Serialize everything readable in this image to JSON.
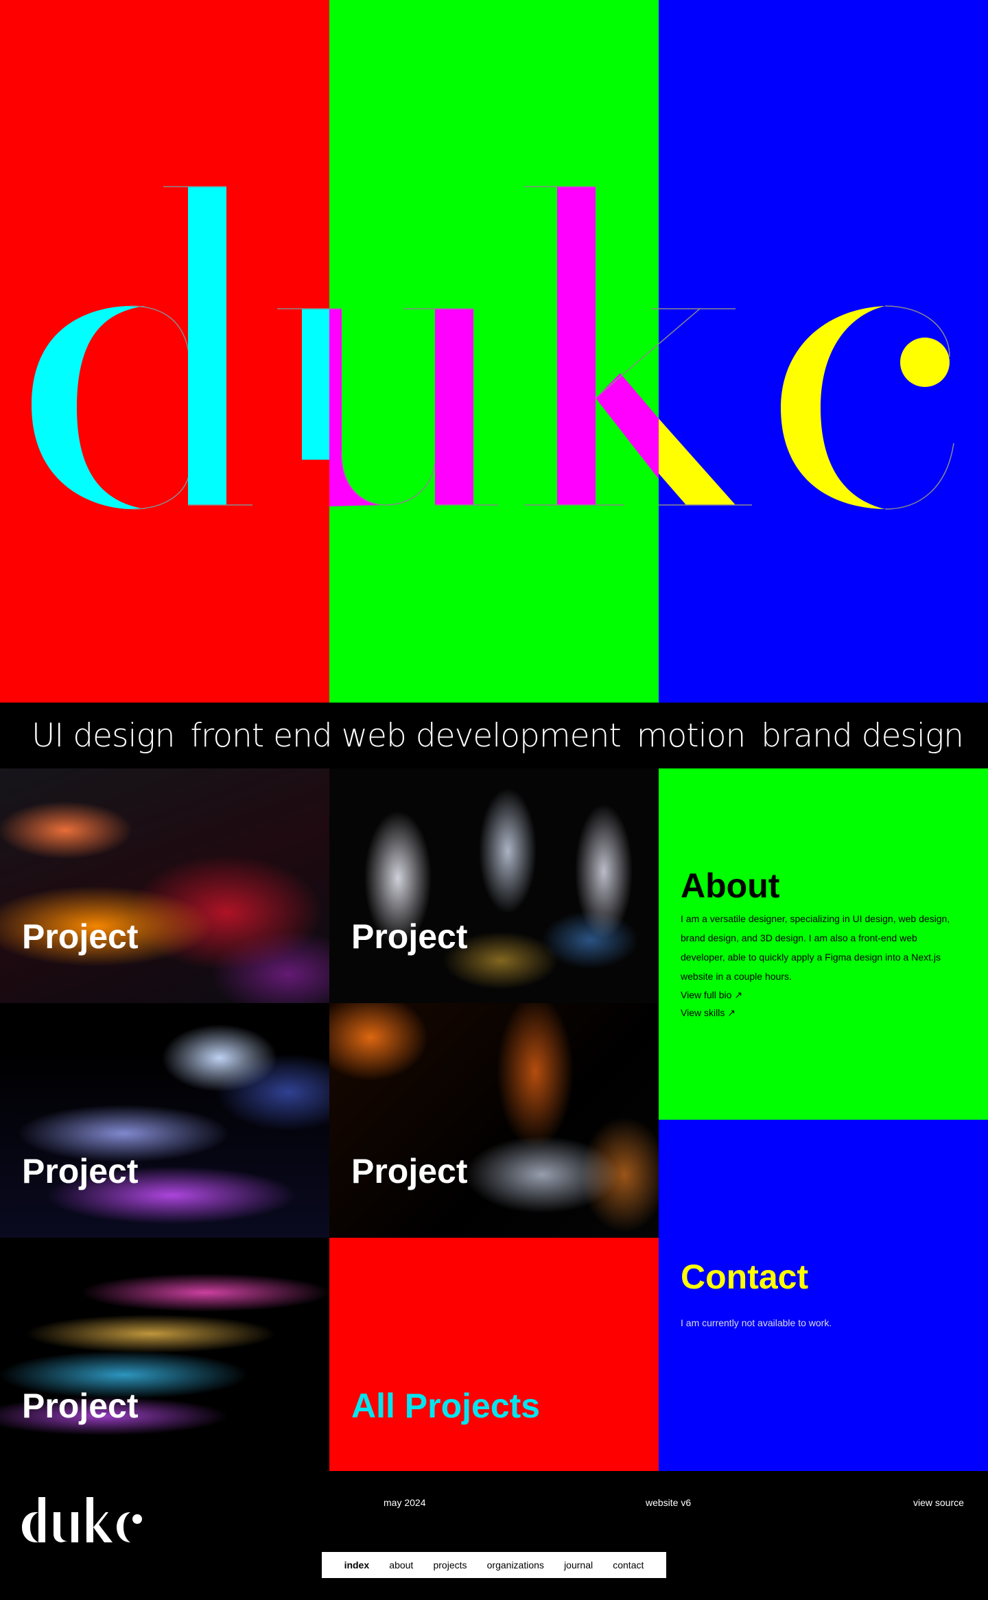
{
  "hero": {
    "wordmark": "duke",
    "colors": {
      "left": "#ff0000",
      "middle": "#00ff00",
      "right": "#0000ff",
      "letter_left": "#00ffff",
      "letter_middle": "#ff00ff",
      "letter_right": "#ffff00"
    }
  },
  "services": [
    "UI design",
    "front end web development",
    "motion",
    "brand design"
  ],
  "projects": [
    {
      "label": "Project"
    },
    {
      "label": "Project"
    },
    {
      "label": "Project"
    },
    {
      "label": "Project"
    },
    {
      "label": "Project"
    }
  ],
  "all_projects": {
    "label": "All Projects",
    "color": "#00e5f0"
  },
  "about": {
    "title": "About",
    "text": "I am a versatile designer, specializing in UI design, web design, brand design, and 3D design. I am also a front-end web developer, able to quickly apply a Figma design into a Next.js website in a couple hours.",
    "link_bio": "View full bio",
    "link_skills": "View skills",
    "link_icon": "arrow-up-right-icon"
  },
  "contact": {
    "title": "Contact",
    "text": "I am currently not available to work.",
    "title_color": "#ffff00"
  },
  "footer": {
    "logo": "duke",
    "date": "may 2024",
    "version": "website v6",
    "source": "view source",
    "nav": [
      "index",
      "about",
      "projects",
      "organizations",
      "journal",
      "contact"
    ],
    "active_nav": "index"
  }
}
